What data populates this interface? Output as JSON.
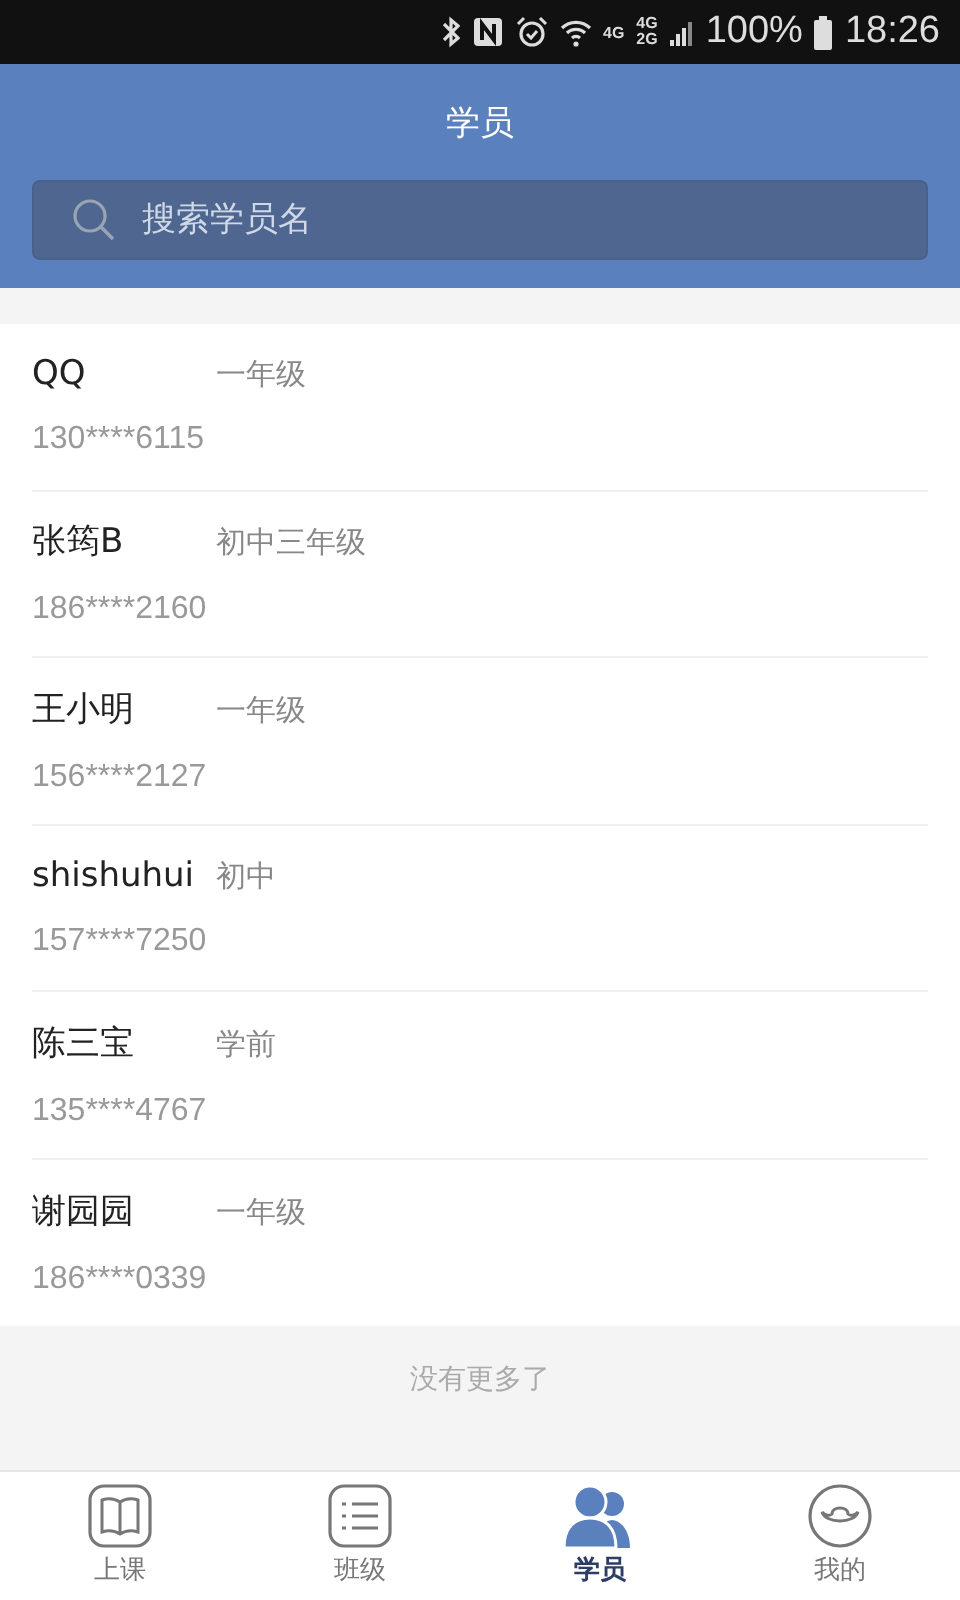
{
  "status_bar": {
    "network_1": "4G",
    "network_2": "4G",
    "network_3": "2G",
    "battery": "100%",
    "time": "18:26"
  },
  "header": {
    "title": "学员",
    "search": {
      "placeholder": "搜索学员名"
    }
  },
  "students": [
    {
      "name": "QQ",
      "grade": "一年级",
      "phone": "130****6115"
    },
    {
      "name": "张筠B",
      "grade": "初中三年级",
      "phone": "186****2160"
    },
    {
      "name": "王小明",
      "grade": "一年级",
      "phone": "156****2127"
    },
    {
      "name": "shishuhui",
      "grade": "初中",
      "phone": "157****7250"
    },
    {
      "name": "陈三宝",
      "grade": "学前",
      "phone": "135****4767"
    },
    {
      "name": "谢园园",
      "grade": "一年级",
      "phone": "186****0339"
    }
  ],
  "list_end": "没有更多了",
  "tabs": [
    {
      "kind": "book",
      "label": "上课",
      "selected": false
    },
    {
      "kind": "list",
      "label": "班级",
      "selected": false
    },
    {
      "kind": "people",
      "label": "学员",
      "selected": true
    },
    {
      "kind": "ingot",
      "label": "我的",
      "selected": false
    }
  ]
}
